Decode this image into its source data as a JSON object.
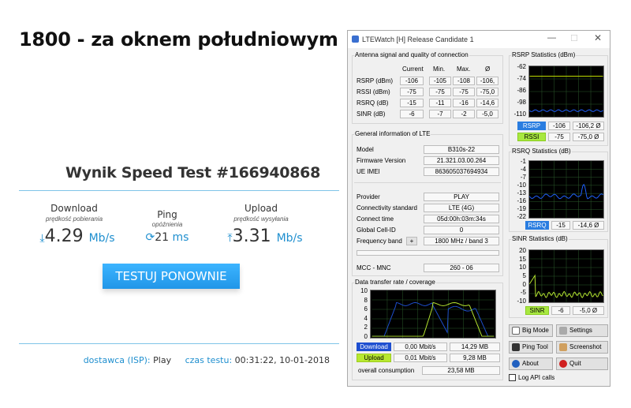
{
  "heading": "1800 - za oknem południowym",
  "speedtest": {
    "title": "Wynik Speed Test #166940868",
    "download": {
      "label": "Download",
      "sub": "prędkość pobierania",
      "value": "4.29",
      "unit": "Mb/s"
    },
    "ping": {
      "label": "Ping",
      "sub": "opóźnienia",
      "value": "21",
      "unit": "ms"
    },
    "upload": {
      "label": "Upload",
      "sub": "prędkość wysyłania",
      "value": "3.31",
      "unit": "Mb/s"
    },
    "button": "TESTUJ PONOWNIE",
    "isp_label": "dostawca (ISP):",
    "isp_value": "Play",
    "time_label": "czas testu:",
    "time_value": "00:31:22, 10-01-2018"
  },
  "window": {
    "title": "LTEWatch [H]  Release Candidate 1",
    "antenna": {
      "title": "Antenna signal and quality of connection",
      "headers": [
        "Current",
        "Min.",
        "Max.",
        "Ø"
      ],
      "rows": [
        {
          "label": "RSRP (dBm)",
          "values": [
            "-106",
            "-105",
            "-108",
            "-106,"
          ]
        },
        {
          "label": "RSSI (dBm)",
          "values": [
            "-75",
            "-75",
            "-75",
            "-75,0"
          ]
        },
        {
          "label": "RSRQ (dB)",
          "values": [
            "-15",
            "-11",
            "-16",
            "-14,6"
          ]
        },
        {
          "label": "SINR (dB)",
          "values": [
            "-6",
            "-7",
            "-2",
            "-5,0"
          ]
        }
      ]
    },
    "general": {
      "title": "General information of LTE",
      "model_label": "Model",
      "model": "B310s-22",
      "fw_label": "Firmware Version",
      "fw": "21.321.03.00.264",
      "imei_label": "UE IMEI",
      "imei": "863605037694934",
      "provider_label": "Provider",
      "provider": "PLAY",
      "std_label": "Connectivity standard",
      "std": "LTE (4G)",
      "conn_label": "Connect time",
      "conn": "05d:00h:03m:34s",
      "cell_label": "Global Cell-ID",
      "cell": "0",
      "band_label": "Frequency band",
      "band_btn": "+",
      "band": "1800 MHz / band 3",
      "mcc_label": "MCC - MNC",
      "mcc": "260 - 06"
    },
    "transfer": {
      "title": "Data transfer rate / coverage",
      "ticks": [
        "10",
        "8",
        "6",
        "4",
        "2",
        "0"
      ],
      "download_label": "Download",
      "download_rate": "0,00 Mbit/s",
      "download_total": "14,29 MB",
      "upload_label": "Upload",
      "upload_rate": "0,01 Mbit/s",
      "upload_total": "9,28 MB",
      "overall_label": "overall consumption",
      "overall": "23,58 MB"
    },
    "rsrp_stats": {
      "title": "RSRP Statistics (dBm)",
      "ticks": [
        "-62",
        "-74",
        "-86",
        "-98",
        "-110"
      ],
      "rsrp_label": "RSRP",
      "rsrp_cur": "-106",
      "rsrp_avg": "-106,2 Ø",
      "rssi_label": "RSSI",
      "rssi_cur": "-75",
      "rssi_avg": "-75,0 Ø"
    },
    "rsrq_stats": {
      "title": "RSRQ Statistics (dB)",
      "ticks": [
        "-1",
        "-4",
        "-7",
        "-10",
        "-13",
        "-16",
        "-19",
        "-22"
      ],
      "label": "RSRQ",
      "cur": "-15",
      "avg": "-14,6 Ø"
    },
    "sinr_stats": {
      "title": "SINR Statistics (dB)",
      "ticks": [
        "20",
        "15",
        "10",
        "5",
        "0",
        "-5",
        "-10"
      ],
      "label": "SINR",
      "cur": "-6",
      "avg": "-5,0 Ø"
    },
    "buttons": {
      "bigmode": "Big Mode",
      "settings": "Settings",
      "ping": "Ping Tool",
      "screenshot": "Screenshot",
      "about": "About",
      "quit": "Quit",
      "log": "Log API calls"
    },
    "colors": {
      "download": "#1e4fd0",
      "upload": "#b8e830",
      "rsrp_line": "#c8e800",
      "rssi_line": "#2060ff"
    }
  }
}
